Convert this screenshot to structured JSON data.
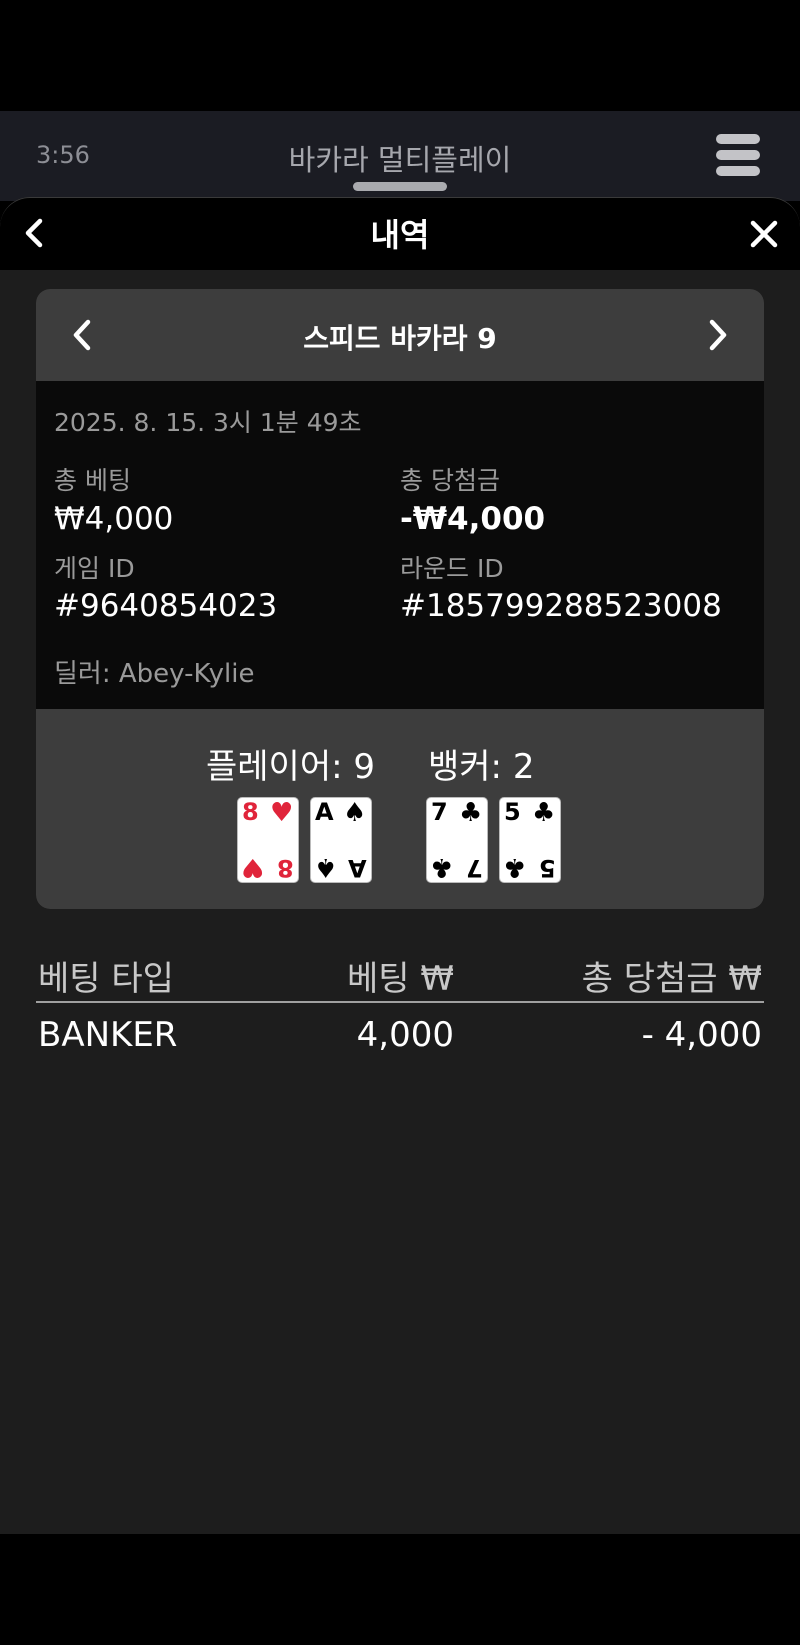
{
  "app": {
    "time": "3:56",
    "title": "바카라 멀티플레이"
  },
  "sheet": {
    "title": "내역"
  },
  "game": {
    "name": "스피드 바카라 9",
    "datetime": "2025. 8. 15. 3시 1분 49초",
    "total_bet_label": "총 베팅",
    "total_bet_value": "₩4,000",
    "total_win_label": "총 당첨금",
    "total_win_value": "-₩4,000",
    "game_id_label": "게임 ID",
    "game_id_value": "#9640854023",
    "round_id_label": "라운드 ID",
    "round_id_value": "#185799288523008",
    "dealer": "딜러: Abey-Kylie"
  },
  "result": {
    "player_label": "플레이어: 9",
    "banker_label": "뱅커: 2",
    "player_cards": [
      {
        "rank": "8",
        "suit": "♥",
        "color": "red"
      },
      {
        "rank": "A",
        "suit": "♠",
        "color": "black"
      }
    ],
    "banker_cards": [
      {
        "rank": "7",
        "suit": "♣",
        "color": "black"
      },
      {
        "rank": "5",
        "suit": "♣",
        "color": "black"
      }
    ]
  },
  "bets_table": {
    "headers": [
      "베팅 타입",
      "베팅 ₩",
      "총 당첨금 ₩"
    ],
    "rows": [
      [
        "BANKER",
        "4,000",
        "- 4,000"
      ]
    ]
  },
  "icons": {
    "back": "chevron-left-icon",
    "close": "close-icon",
    "menu": "hamburger-menu-icon",
    "prev": "chevron-left-icon",
    "next": "chevron-right-icon"
  },
  "colors": {
    "red_suit": "#e0243a",
    "sheet_bg": "#1d1d1d",
    "card_header_bg": "#3d3d3d"
  }
}
